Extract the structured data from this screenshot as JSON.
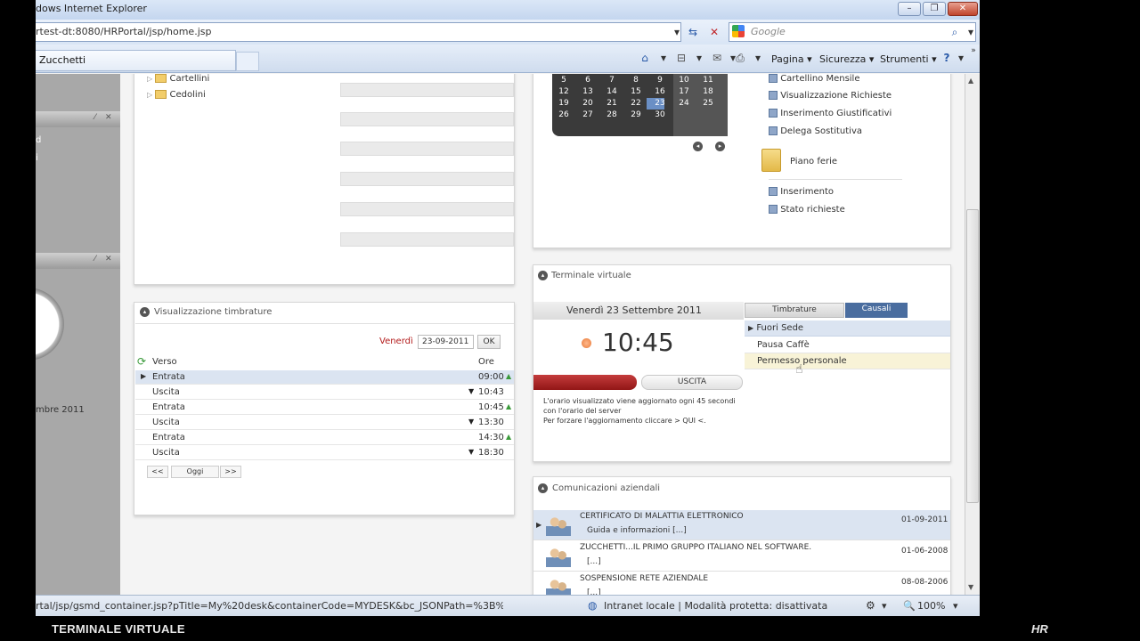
{
  "window": {
    "title": "dows Internet Explorer",
    "minimize": "–",
    "maximize": "❐",
    "close": "✕"
  },
  "address": {
    "url": "rtest-dt:8080/HRPortal/jsp/home.jsp",
    "search_placeholder": "Google"
  },
  "tabs": {
    "active_label": "Zucchetti"
  },
  "commands": {
    "pagina": "Pagina ▾",
    "sicurezza": "Sicurezza ▾",
    "strumenti": "Strumenti ▾"
  },
  "left_sidebar": {
    "partial_text_1": "d",
    "partial_text_2": "i",
    "date_fragment": "mbre 2011"
  },
  "tree": {
    "items": [
      "Cartellini",
      "Cedolini"
    ]
  },
  "calendar": {
    "rows": [
      [
        "5",
        "6",
        "7",
        "8",
        "9",
        "10",
        "11"
      ],
      [
        "12",
        "13",
        "14",
        "15",
        "16",
        "17",
        "18"
      ],
      [
        "19",
        "20",
        "21",
        "22",
        "23",
        "24",
        "25"
      ],
      [
        "26",
        "27",
        "28",
        "29",
        "30",
        "",
        ""
      ]
    ],
    "selected_day": "23"
  },
  "right_menu": {
    "items": [
      "Cartellino Mensile",
      "Visualizzazione Richieste",
      "Inserimento Giustificativi",
      "Delega Sostitutiva"
    ],
    "folder_label": "Piano ferie",
    "sub_items": [
      "Inserimento",
      "Stato richieste"
    ]
  },
  "timbrature": {
    "title": "Visualizzazione timbrature",
    "day": "Venerdì",
    "date_value": "23-09-2011",
    "ok": "OK",
    "col_verso": "Verso",
    "col_ore": "Ore",
    "rows": [
      {
        "verso": "Entrata",
        "ore": "09:00",
        "dir": "▲"
      },
      {
        "verso": "Uscita",
        "ore": "10:43",
        "dir": "▼"
      },
      {
        "verso": "Entrata",
        "ore": "10:45",
        "dir": "▲"
      },
      {
        "verso": "Uscita",
        "ore": "13:30",
        "dir": "▼"
      },
      {
        "verso": "Entrata",
        "ore": "14:30",
        "dir": "▲"
      },
      {
        "verso": "Uscita",
        "ore": "18:30",
        "dir": "▼"
      }
    ],
    "prev": "<<",
    "today": "Oggi",
    "next": ">>"
  },
  "terminale": {
    "title": "Terminale virtuale",
    "date": "Venerdì 23 Settembre 2011",
    "time": "10:45",
    "tab_timbrature": "Timbrature",
    "tab_causali": "Causali",
    "causali": [
      "Fuori Sede",
      "Pausa Caffè",
      "Permesso personale"
    ],
    "uscita": "USCITA",
    "note_1": "L'orario visualizzato viene aggiornato ogni 45 secondi",
    "note_2": "con l'orario del server",
    "note_3": "Per forzare l'aggiornamento cliccare > QUI <."
  },
  "comunicazioni": {
    "title": "Comunicazioni aziendali",
    "items": [
      {
        "title": "CERTIFICATO DI MALATTIA ELETTRONICO",
        "sub": "Guida e informazioni [...]",
        "date": "01-09-2011"
      },
      {
        "title": "ZUCCHETTI...IL PRIMO GRUPPO ITALIANO NEL SOFTWARE.",
        "sub": "[...]",
        "date": "01-06-2008"
      },
      {
        "title": "SOSPENSIONE RETE AZIENDALE",
        "sub": "[...]",
        "date": "08-08-2006"
      }
    ]
  },
  "status": {
    "url": "rtal/jsp/gsmd_container.jsp?pTitle=My%20desk&containerCode=MYDESK&bc_JSONPath=%3B%2",
    "zone": "Intranet locale | Modalità protetta: disattivata",
    "zoom": "100%"
  },
  "caption": {
    "bottom_left": "TERMINALE VIRTUALE",
    "bottom_right": "HR"
  },
  "colors": {
    "accent_red": "#b31b1b",
    "selected_blue": "#4a6d9f",
    "calendar_bg": "#3a3a3a"
  }
}
